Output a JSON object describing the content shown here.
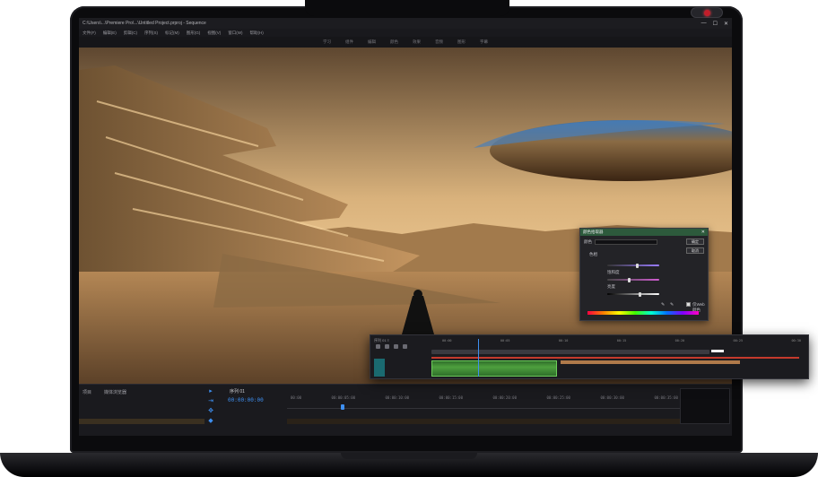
{
  "window": {
    "title": "C:\\Users\\...\\Premiere Pro\\...\\Untitled Project.prproj - Sequence",
    "controls": [
      "—",
      "☐",
      "✕"
    ]
  },
  "menubar": {
    "items": [
      "文件(F)",
      "编辑(E)",
      "剪辑(C)",
      "序列(S)",
      "标记(M)",
      "图形(G)",
      "视图(V)",
      "窗口(W)",
      "帮助(H)"
    ]
  },
  "workspace": {
    "tabs": [
      "学习",
      "组件",
      "编辑",
      "颜色",
      "效果",
      "音频",
      "图形",
      "字幕"
    ]
  },
  "bottom_panel": {
    "tab_project": "项目",
    "tab_media": "媒体浏览器",
    "sequence_tab": "序列 01",
    "timecode": "00:00:00:00",
    "ruler": [
      "00:00",
      "00:00:05:00",
      "00:00:10:00",
      "00:00:15:00",
      "00:00:20:00",
      "00:00:25:00",
      "00:00:30:00",
      "00:00:35:00"
    ]
  },
  "color_dialog": {
    "title": "颜色拾取器",
    "close": "✕",
    "mode_label": "颜色",
    "ok_label": "确定",
    "cancel_label": "取消",
    "label_hue": "色相",
    "label_sat": "饱和度",
    "label_light": "亮度",
    "checkbox_label": "仅Web颜色",
    "hue_level": 0.55,
    "sat_level": 0.4,
    "light_level": 0.6
  },
  "timeline_popout": {
    "header": "序列 01 ≡",
    "ticks": [
      "00:00",
      "00:05",
      "00:10",
      "00:15",
      "00:20",
      "00:25",
      "00:30"
    ]
  },
  "colors": {
    "accent": "#3e8ff0",
    "dialog_header": "#2d5a3c",
    "audio_clip": "#4ea03e",
    "marker": "#c53a2c"
  }
}
